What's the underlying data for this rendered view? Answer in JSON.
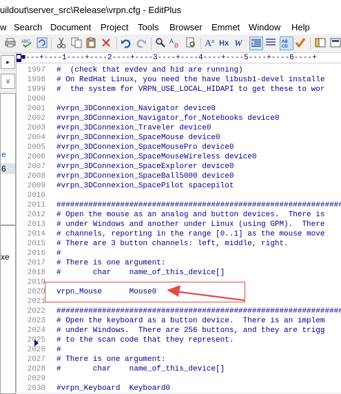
{
  "title": "uildout\\server_src\\Release\\vrpn.cfg - EditPlus",
  "menu": [
    {
      "label": "w"
    },
    {
      "label": "Search"
    },
    {
      "label": "Document"
    },
    {
      "label": "Project"
    },
    {
      "label": "Tools"
    },
    {
      "label": "Browser"
    },
    {
      "label": "Emmet"
    },
    {
      "label": "Window"
    },
    {
      "label": "Help"
    }
  ],
  "toolbar_icons": [
    "print-icon",
    "spellcheck-icon",
    "refresh-icon",
    "cut-icon",
    "copy-icon",
    "paste-icon",
    "delete-icon",
    "undo-icon",
    "redo-icon",
    "find-icon",
    "replace-icon",
    "replace-in-files-icon",
    "font-icon",
    "hex-icon",
    "word-wrap-icon",
    "tab-indent-icon",
    "line-number-icon",
    "column-select-icon",
    "spell-check-mark-icon",
    "toggle-pane-icon",
    "screen-icon"
  ],
  "left_panel": {
    "fragments": [
      "▸",
      "∨",
      "e",
      "6",
      "xe"
    ]
  },
  "ruler": "■---+----1----+----2----+----3----+----4----+----5----+----6----+",
  "lines": [
    {
      "n": "1997",
      "text": "#  (check that evdev and hid are running)"
    },
    {
      "n": "1998",
      "text": "# On RedHat Linux, you need the have libusb1-devel installe"
    },
    {
      "n": "1999",
      "text": "#  the system for VRPN_USE_LOCAL_HIDAPI to get these to wor"
    },
    {
      "n": "2000",
      "text": ""
    },
    {
      "n": "2001",
      "text": "#vrpn_3DConnexion_Navigator device0"
    },
    {
      "n": "2002",
      "text": "#vrpn_3DConnexion_Navigator_for_Notebooks device0"
    },
    {
      "n": "2003",
      "text": "#vrpn_3DConnexion_Traveler device0"
    },
    {
      "n": "2004",
      "text": "#vrpn_3DConnexion_SpaceMouse device0"
    },
    {
      "n": "2005",
      "text": "#vrpn_3DConnexion_SpaceMousePro device0"
    },
    {
      "n": "2006",
      "text": "#vrpn_3DConnexion_SpaceMouseWireless device0"
    },
    {
      "n": "2007",
      "text": "#vrpn_3DConnexion_SpaceExplorer device0"
    },
    {
      "n": "2008",
      "text": "#vrpn_3DConnexion_SpaceBall5000 device0"
    },
    {
      "n": "2009",
      "text": "#vrpn_3DConnexion_SpacePilot spacepilot"
    },
    {
      "n": "2010",
      "text": ""
    },
    {
      "n": "2011",
      "text": "################################################################"
    },
    {
      "n": "2012",
      "text": "# Open the mouse as an analog and button devices.  There is"
    },
    {
      "n": "2013",
      "text": "# under Windows and another under Linux (using GPM).  There"
    },
    {
      "n": "2014",
      "text": "# channels, reporting in the range [0..1] as the mouse move"
    },
    {
      "n": "2015",
      "text": "# There are 3 button channels: left, middle, right."
    },
    {
      "n": "2016",
      "text": "#"
    },
    {
      "n": "2017",
      "text": "# There is one argument:"
    },
    {
      "n": "2018",
      "text": "#       char    name_of_this_device[]"
    },
    {
      "n": "2019",
      "text": ""
    },
    {
      "n": "2020",
      "text": "vrpn_Mouse      Mouse0"
    },
    {
      "n": "2021",
      "text": ""
    },
    {
      "n": "2022",
      "text": "################################################################"
    },
    {
      "n": "2023",
      "text": "# Open the keyboard as a button device.  There is an implem"
    },
    {
      "n": "2024",
      "text": "# under Windows.  There are 256 buttons, and they are trigg"
    },
    {
      "n": "2025",
      "text": "# to the scan code that they represent."
    },
    {
      "n": "2026",
      "text": "#"
    },
    {
      "n": "2027",
      "text": "# There is one argument:"
    },
    {
      "n": "2028",
      "text": "#       char    name_of_this_device[]"
    },
    {
      "n": "2029",
      "text": ""
    },
    {
      "n": "2030",
      "text": "#vrpn_Keyboard  Keyboard0"
    }
  ],
  "annotation_color": "#e24a4a",
  "current_line": "2020"
}
